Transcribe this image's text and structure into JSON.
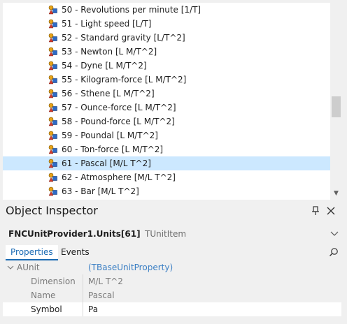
{
  "tree": {
    "items": [
      {
        "label": "50 - Revolutions per minute [1/T]",
        "selected": false
      },
      {
        "label": "51 - Light speed [L/T]",
        "selected": false
      },
      {
        "label": "52 - Standard gravity [L/T^2]",
        "selected": false
      },
      {
        "label": "53 - Newton [L M/T^2]",
        "selected": false
      },
      {
        "label": "54 - Dyne [L M/T^2]",
        "selected": false
      },
      {
        "label": "55 - Kilogram-force [L M/T^2]",
        "selected": false
      },
      {
        "label": "56 - Sthene [L M/T^2]",
        "selected": false
      },
      {
        "label": "57 - Ounce-force [L M/T^2]",
        "selected": false
      },
      {
        "label": "58 - Pound-force [L M/T^2]",
        "selected": false
      },
      {
        "label": "59 - Poundal [L M/T^2]",
        "selected": false
      },
      {
        "label": "60 - Ton-force [L M/T^2]",
        "selected": false
      },
      {
        "label": "61 - Pascal [M/L T^2]",
        "selected": true
      },
      {
        "label": "62 - Atmosphere [M/L T^2]",
        "selected": false
      },
      {
        "label": "63 - Bar [M/L T^2]",
        "selected": false
      }
    ],
    "item_icon": "unit-component-icon",
    "selection_color": "#cce8ff"
  },
  "inspector": {
    "title": "Object Inspector",
    "object_name": "FNCUnitProvider1.Units[61]",
    "object_type": "TUnitItem",
    "tabs": [
      "Properties",
      "Events"
    ],
    "active_tab": "Properties",
    "accent_color": "#1a6ab3",
    "properties": [
      {
        "name": "AUnit",
        "value": "(TBaseUnitProperty)"
      },
      {
        "name": "Dimension",
        "value": "M/L T^2"
      },
      {
        "name": "Name",
        "value": "Pascal"
      },
      {
        "name": "Symbol",
        "value": "Pa"
      }
    ]
  }
}
